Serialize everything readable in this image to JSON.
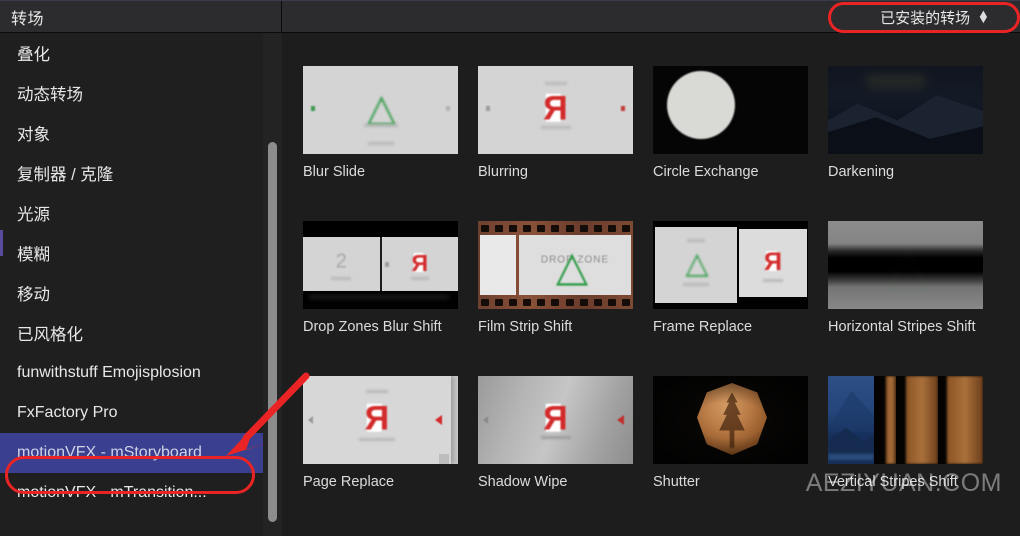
{
  "header": {
    "sidebar_title": "转场",
    "popup_label": "已安装的转场",
    "popup_icon": "chevron-up-down-icon"
  },
  "sidebar": {
    "items": [
      {
        "label": "叠化",
        "selected": false
      },
      {
        "label": "动态转场",
        "selected": false
      },
      {
        "label": "对象",
        "selected": false
      },
      {
        "label": "复制器 / 克隆",
        "selected": false
      },
      {
        "label": "光源",
        "selected": false
      },
      {
        "label": "模糊",
        "selected": false
      },
      {
        "label": "移动",
        "selected": false
      },
      {
        "label": "已风格化",
        "selected": false
      },
      {
        "label": "funwithstuff Emojisplosion",
        "selected": false
      },
      {
        "label": "FxFactory Pro",
        "selected": false
      },
      {
        "label": "motionVFX - mStoryboard",
        "selected": true
      },
      {
        "label": "motionVFX - mTransition...",
        "selected": false
      }
    ]
  },
  "browser": {
    "items": [
      {
        "name": "Blur Slide",
        "art": "blur-slide"
      },
      {
        "name": "Blurring",
        "art": "blurring"
      },
      {
        "name": "Circle Exchange",
        "art": "circle-exchange"
      },
      {
        "name": "Darkening",
        "art": "darkening"
      },
      {
        "name": "Drop Zones Blur Shift",
        "art": "drop-zones"
      },
      {
        "name": "Film Strip Shift",
        "art": "film-strip"
      },
      {
        "name": "Frame Replace",
        "art": "frame-replace"
      },
      {
        "name": "Horizontal Stripes Shift",
        "art": "horizontal-stripes"
      },
      {
        "name": "Page Replace",
        "art": "page-replace"
      },
      {
        "name": "Shadow Wipe",
        "art": "shadow-wipe"
      },
      {
        "name": "Shutter",
        "art": "shutter"
      },
      {
        "name": "Vertical Stripes Shift",
        "art": "vertical-stripes"
      }
    ],
    "film_strip_text": "DROP ZONE",
    "drop_zone_number": "2"
  },
  "annotations": {
    "watermark": "AEZIYUAN.COM",
    "highlight_color": "#ea2424",
    "selection_color": "#3b3f8f"
  }
}
